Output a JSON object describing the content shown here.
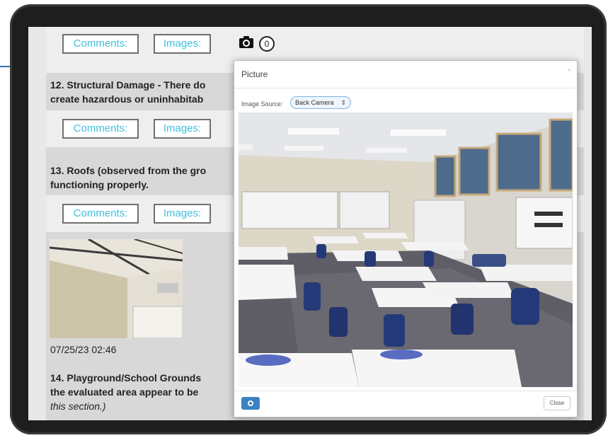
{
  "top_buttons": {
    "comments": "Comments:",
    "images": "Images:",
    "image_count": "0"
  },
  "q12": {
    "line1": "12. Structural Damage - There do",
    "line2": "create hazardous or uninhabitab",
    "comments": "Comments:",
    "images": "Images:"
  },
  "q13": {
    "line1": "13. Roofs (observed from the gro",
    "line2": "functioning properly.",
    "comments": "Comments:",
    "images": "Images:"
  },
  "thumbnail": {
    "timestamp": "07/25/23 02:46"
  },
  "q14": {
    "line1": "14. Playground/School Grounds",
    "line2": "the evaluated area appear to be",
    "line3": "this section.)"
  },
  "modal": {
    "title": "Picture",
    "close_x": "×",
    "image_source_label": "Image Source:",
    "image_source_value": "Back Camera",
    "close_button": "Close"
  },
  "icons": {
    "camera": "camera-icon",
    "capture": "camera-capture-icon",
    "select_arrow": "chevron-updown-icon"
  },
  "colors": {
    "accent": "#3fc0de",
    "capture_button": "#3a82c4",
    "select_border": "#7fb2e0"
  }
}
